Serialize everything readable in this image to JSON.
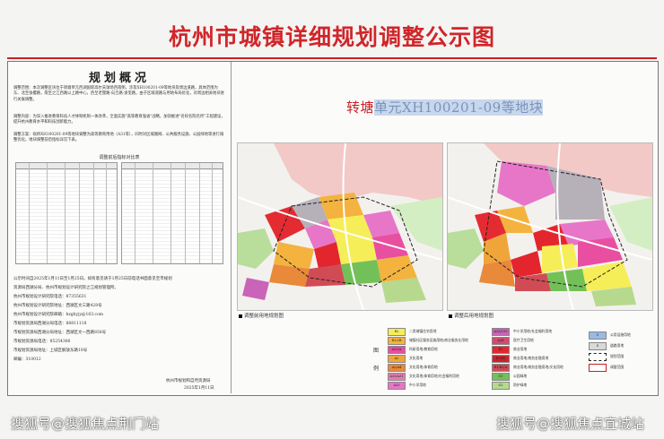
{
  "header": {
    "title": "杭州市城镇详细规划调整公示图"
  },
  "overview": {
    "heading": "规划概况",
    "p1": "调整范围：本次调整区块位于转塘单元西湖国际高尔夫球场西南侧，涉及XH100201-09等地块及周边道路，具体范围为东、北至张樱路，南至之江西路以上路中心，西至老狸路-向吉路-浙里路。由于区域道路与用地布局优化，对周边相关地块进行关联调整。",
    "p2": "调整内容：为深入推进教育科技人才体制机制一体改革，全面实施\"高等教育强省\"战略，加快推进\"名校名院名所\"工程建设，提升杭州教育水平和科技创新能力。",
    "p3": "调整方案：拟将XH100201-09等地块调整为高等教育用地（A31等），同时对区域路网、公共服务设施、公园绿地等进行调整优化，地块调整前后指标详见下表。",
    "table_title": "调整前后指标对比表",
    "notice": [
      "公示时间自2025年1月11日至1月25日。如有意见请于1月25日前电话书面意见至市规划",
      "资源局西湖分局、杭州市规划设计研究院之江规划管理所。",
      "杭州市规划设计研究院电话：87355631",
      "杭州市规划设计研究院地址：西湖区文三路428号",
      "杭州市规划设计研究院邮箱：hzghyjy@163.com",
      "市规划资源局西湖分局电话：88811118",
      "市规划资源局西湖分局地址：西湖区文一西路858号",
      "市规划资源局电话：85254306",
      "市规划资源局地址：上城区解放东路18号",
      "邮编：310012"
    ],
    "signature": "杭州市规划和自然资源局",
    "date": "2025年1月11日"
  },
  "maps": {
    "subtitle_prefix": "转塘",
    "subtitle_highlight": "单元XH100201-09等地块",
    "before_label": "调整前用地规划图",
    "after_label": "调整后用地规划图"
  },
  "legend": {
    "heading_1": "图",
    "heading_2": "例",
    "items": [
      {
        "code": "R2",
        "label": "二类城镇住宅用地",
        "color": "#f6ee58"
      },
      {
        "code": "R22/B",
        "label": "城镇社区服务设施用地/商业服务业用地",
        "color": "#f3b33e"
      },
      {
        "code": "A33/A",
        "label": "科研用地/教育用地",
        "color": "#e84fa1"
      },
      {
        "code": "A2",
        "label": "文化用地",
        "color": "#f0a53a"
      },
      {
        "code": "A2/A4",
        "label": "文化用地/体育用地",
        "color": "#e9893a"
      },
      {
        "code": "A33/A31",
        "label": "文化用地/体育用地/社会福利用地",
        "color": "#e27fb4"
      },
      {
        "code": "A33",
        "label": "中小学用地",
        "color": "#e776c9"
      },
      {
        "code": "A33/C33",
        "label": "中小学用地/社会福利用地",
        "color": "#c964b8"
      },
      {
        "code": "A34",
        "label": "医疗卫生用地",
        "color": "#d34a6f"
      },
      {
        "code": "B1",
        "label": "商业用地",
        "color": "#e3262e"
      },
      {
        "code": "B1/B2",
        "label": "商业用地/商务金融用地",
        "color": "#c9232b"
      },
      {
        "code": "B1/B2/A",
        "label": "商业用地/商务金融用地/文化用地",
        "color": "#d14b55"
      },
      {
        "code": "G1",
        "label": "公园绿地",
        "color": "#74c058"
      },
      {
        "code": "G2",
        "label": "防护绿地",
        "color": "#b7d98e"
      },
      {
        "code": "U",
        "label": "公用设施用地",
        "color": "#9bb9e3"
      },
      {
        "code": "S",
        "label": "道路用地",
        "color": "#d9d9d9"
      },
      {
        "code": "",
        "label": "规划范围",
        "color": "#ffffff"
      },
      {
        "code": "",
        "label": "调整范围",
        "color": "#ffffff"
      }
    ]
  },
  "watermarks": {
    "left": "搜狐号@搜狐焦点荆门站",
    "right": "搜狐号@搜狐焦点宜城站"
  }
}
